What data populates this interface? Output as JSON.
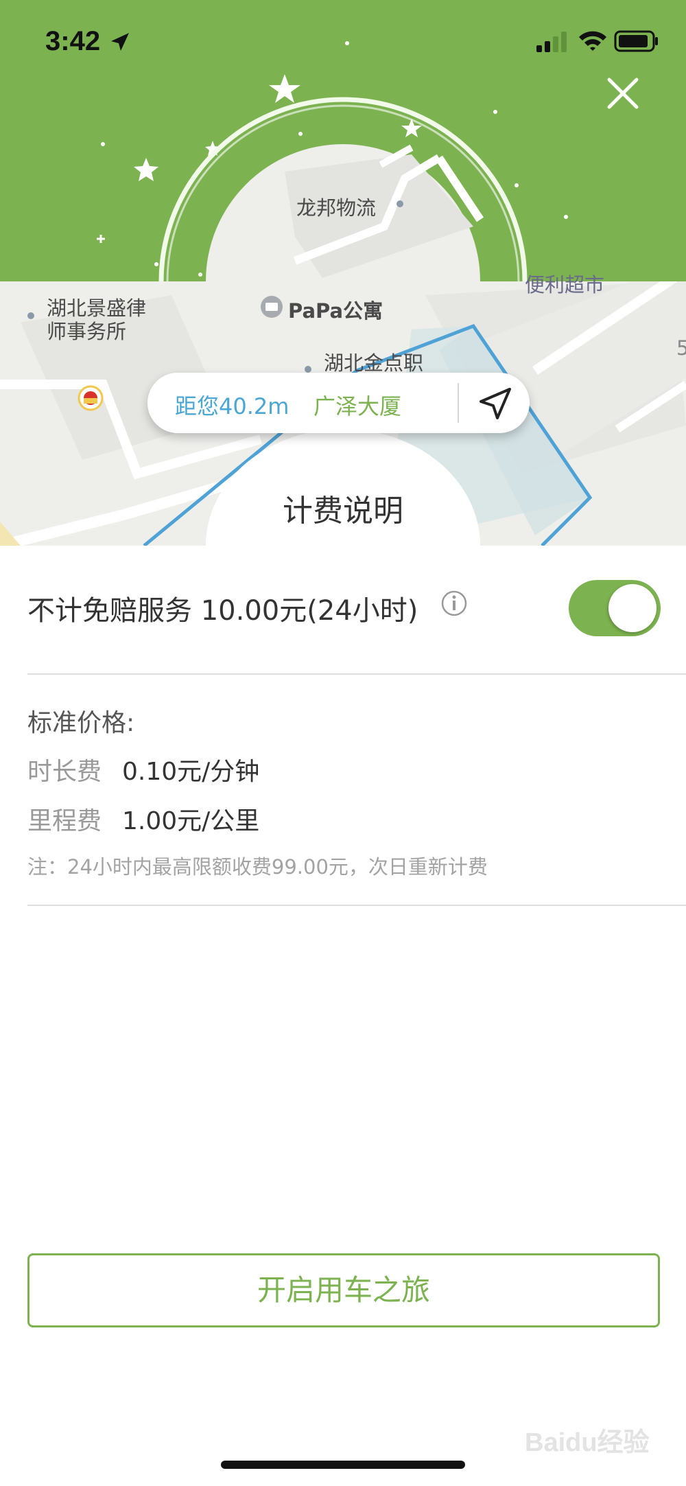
{
  "status_bar": {
    "time": "3:42"
  },
  "map": {
    "labels": [
      "龙邦物流",
      "湖北景盛律",
      "师事务所",
      "PaPa公寓",
      "湖北金点职",
      "便利超市",
      "5"
    ]
  },
  "location_card": {
    "distance": "距您40.2m",
    "place": "广泽大厦"
  },
  "fee_section": {
    "title": "计费说明"
  },
  "service": {
    "label": "不计免赔服务 10.00元(24小时)",
    "enabled": true
  },
  "pricing": {
    "title": "标准价格:",
    "rows": [
      {
        "label": "时长费",
        "value": "0.10元/分钟"
      },
      {
        "label": "里程费",
        "value": "1.00元/公里"
      }
    ],
    "note": "注：24小时内最高限额收费99.00元，次日重新计费"
  },
  "start_button": {
    "label": "开启用车之旅"
  },
  "watermark": "Baidu经验",
  "colors": {
    "brand_green": "#7cb250",
    "accent_blue": "#4aa6d3"
  },
  "icons": [
    "location-arrow-icon",
    "signal-icon",
    "wifi-icon",
    "battery-icon",
    "close-icon",
    "navigate-icon",
    "info-icon",
    "gas-station-icon",
    "hotel-icon"
  ]
}
